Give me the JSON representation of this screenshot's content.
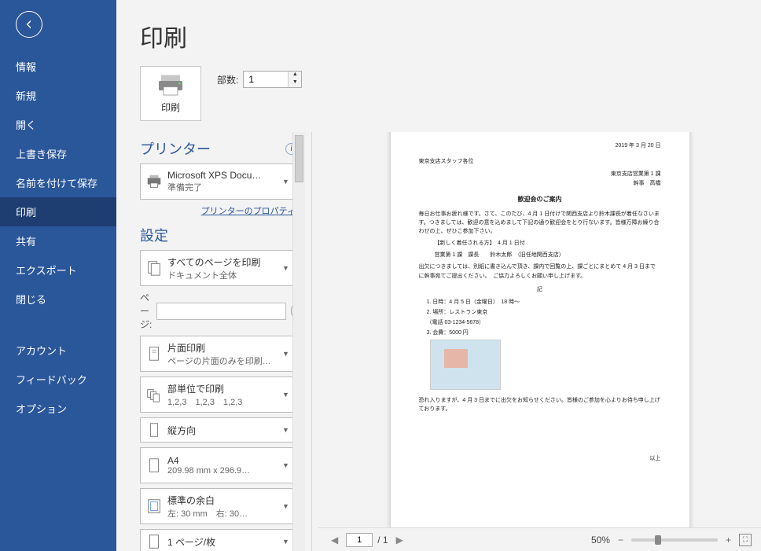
{
  "nav": {
    "items": [
      {
        "label": "情報"
      },
      {
        "label": "新規"
      },
      {
        "label": "開く"
      },
      {
        "label": "上書き保存"
      },
      {
        "label": "名前を付けて保存"
      },
      {
        "label": "印刷",
        "selected": true
      },
      {
        "label": "共有"
      },
      {
        "label": "エクスポート"
      },
      {
        "label": "閉じる"
      }
    ],
    "footer_items": [
      {
        "label": "アカウント"
      },
      {
        "label": "フィードバック"
      },
      {
        "label": "オプション"
      }
    ]
  },
  "page_title": "印刷",
  "print_button_label": "印刷",
  "copies": {
    "label": "部数:",
    "value": "1"
  },
  "section_printer": "プリンター",
  "printer": {
    "name": "Microsoft XPS Docu…",
    "status": "準備完了"
  },
  "printer_properties_link": "プリンターのプロパティ",
  "section_settings": "設定",
  "settings": {
    "scope": {
      "line1": "すべてのページを印刷",
      "line2": "ドキュメント全体"
    },
    "pages_label": "ページ:",
    "pages_value": "",
    "duplex": {
      "line1": "片面印刷",
      "line2": "ページの片面のみを印刷…"
    },
    "collate": {
      "line1": "部単位で印刷",
      "line2": "1,2,3　1,2,3　1,2,3"
    },
    "orient": {
      "line1": "縦方向",
      "line2": ""
    },
    "paper": {
      "line1": "A4",
      "line2": "209.98 mm x 296.9…"
    },
    "margins": {
      "line1": "標準の余白",
      "line2": "左: 30 mm　右: 30…"
    },
    "ppsheet": {
      "line1": "1 ページ/枚",
      "line2": ""
    }
  },
  "preview": {
    "date": "2019 年 3 月 20 日",
    "to": "東京支店スタッフ各位",
    "from1": "東京支店営業第 1 課",
    "from2": "幹事　高橋",
    "doc_title": "歓迎会のご案内",
    "body1": "毎日お仕事お疲れ様です。さて、このたび、4 月 1 日付けで関西支店より鈴木課長が着任なさいます。つきましては、歓迎の意を込めまして下記の通り歓迎会をとり行ないます。皆様万障お繰り合わせの上、ぜひこ参加下さい。",
    "note_indent": "【新しく着任される方】　4 月 1 日付",
    "names": "営業第 1 課　課長　　鈴木太郎　（旧任地関西支店）",
    "body2": "出欠につきましては、別紙に書き込んで頂き、課内で回覧の上、課ごとにまとめて 4 月 3 日までに幹事宛てご提出ください。　ご協力よろしくお願い申し上げます。",
    "ki": "記",
    "li1": "1. 日時：4 月 5 日（金曜日）　18 時～",
    "li2": "2. 場所：レストラン東京",
    "li2b": "（電話 03-1234-5678）",
    "li3": "3. 会費：5000 円",
    "closing": "恐れ入りますが、4 月 3 日までに出欠をお知らせください。皆様のご参加を心よりお待ち申し上げております。",
    "ijou": "以上"
  },
  "footer": {
    "current_page": "1",
    "total_pages": "/ 1",
    "zoom_label": "50%",
    "minus": "−",
    "plus": "+",
    "prev": "◀",
    "next": "▶"
  }
}
